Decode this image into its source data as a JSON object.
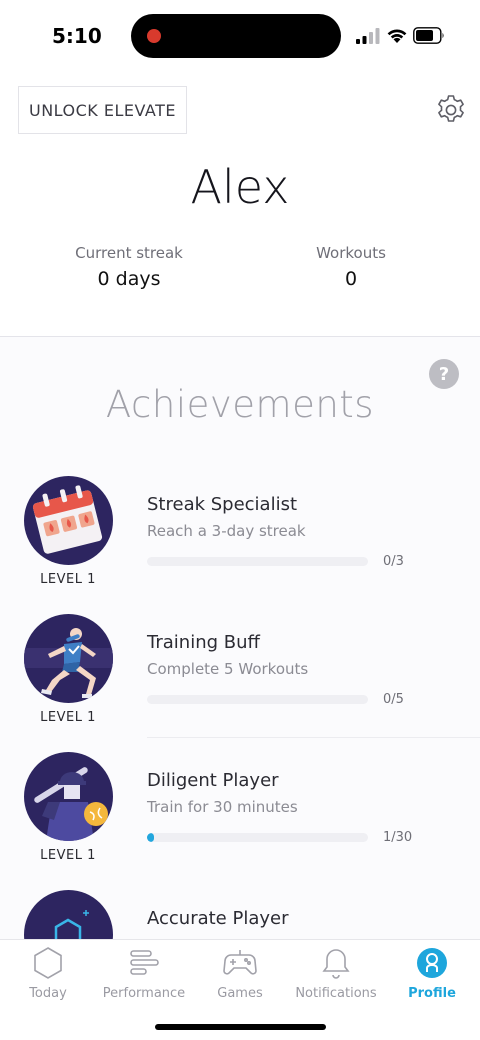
{
  "status_bar": {
    "time": "5:10",
    "icons": [
      "recording-dot-icon",
      "cellular-signal-icon",
      "wifi-icon",
      "battery-icon"
    ]
  },
  "header": {
    "unlock_label": "UNLOCK ELEVATE",
    "settings_icon": "gear-icon",
    "profile_name": "Alex"
  },
  "stats": {
    "streak_label": "Current streak",
    "streak_value": "0 days",
    "workouts_label": "Workouts",
    "workouts_value": "0"
  },
  "achievements": {
    "title": "Achievements",
    "help_label": "?",
    "items": [
      {
        "title": "Streak Specialist",
        "subtitle": "Reach a 3-day streak",
        "level": "LEVEL 1",
        "progress_text": "0/3",
        "progress_fraction": 0,
        "icon": "calendar-streak-icon"
      },
      {
        "title": "Training Buff",
        "subtitle": "Complete 5 Workouts",
        "level": "LEVEL 1",
        "progress_text": "0/5",
        "progress_fraction": 0,
        "icon": "runner-icon"
      },
      {
        "title": "Diligent Player",
        "subtitle": "Train for 30 minutes",
        "level": "LEVEL 1",
        "progress_text": "1/30",
        "progress_fraction": 0.033,
        "icon": "baseball-player-icon"
      },
      {
        "title": "Accurate Player",
        "subtitle": "",
        "level": "",
        "progress_text": "",
        "progress_fraction": 0,
        "icon": "target-hexagon-icon"
      }
    ]
  },
  "tabs": [
    {
      "label": "Today",
      "icon": "hexagon-icon",
      "active": false
    },
    {
      "label": "Performance",
      "icon": "bars-icon",
      "active": false
    },
    {
      "label": "Games",
      "icon": "gamepad-icon",
      "active": false
    },
    {
      "label": "Notifications",
      "icon": "bell-icon",
      "active": false
    },
    {
      "label": "Profile",
      "icon": "profile-icon",
      "active": true
    }
  ],
  "colors": {
    "accent": "#1ea6dc",
    "badge_background": "#2d2560",
    "progress_fill": "#22a6dd"
  }
}
